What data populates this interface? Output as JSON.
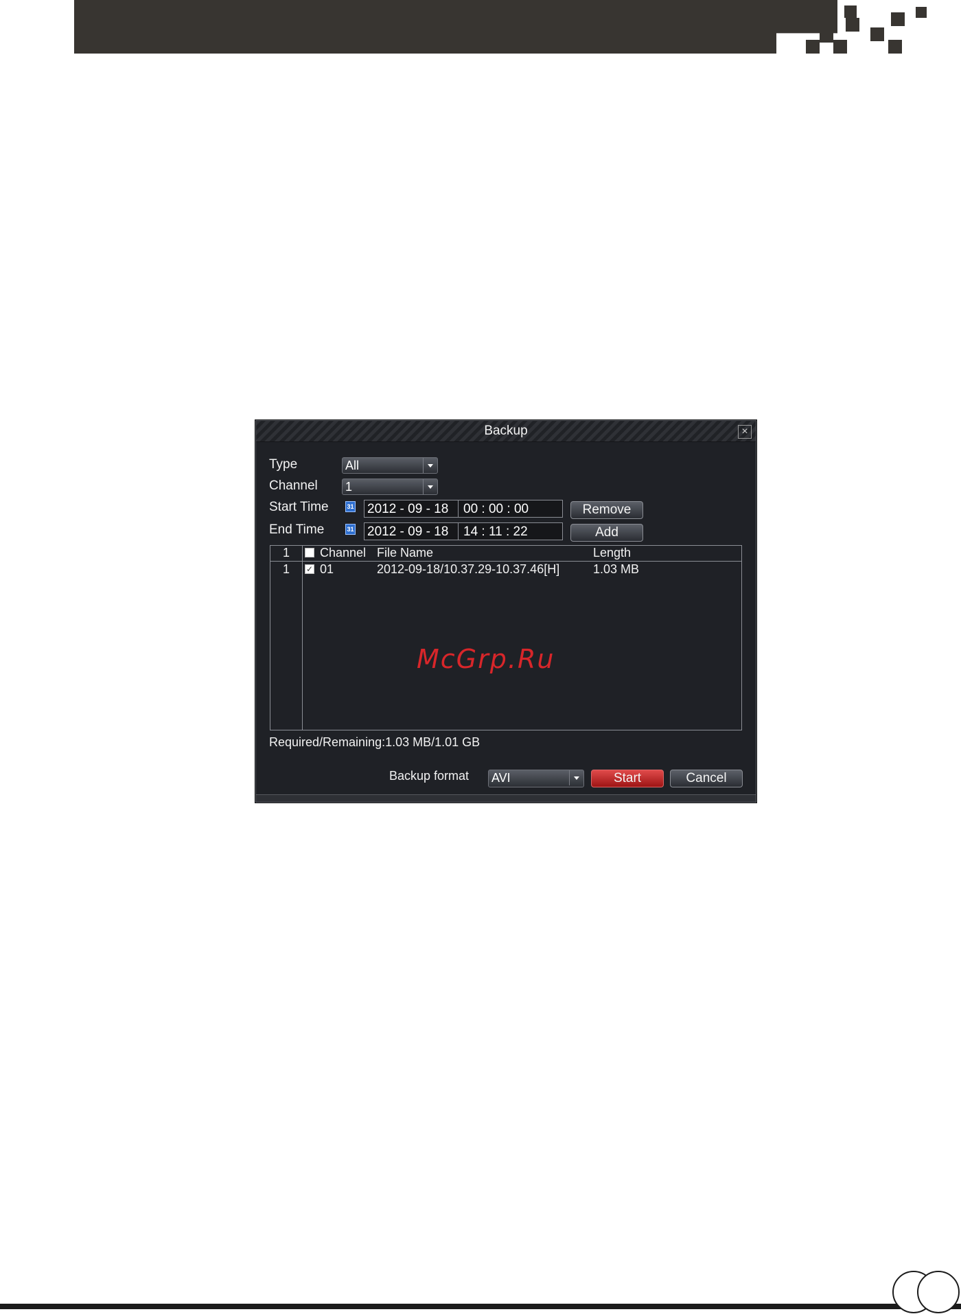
{
  "dialog": {
    "title": "Backup",
    "close_label": "×",
    "type": {
      "label": "Type",
      "value": "All"
    },
    "channel": {
      "label": "Channel",
      "value": "1"
    },
    "start_time": {
      "label": "Start Time",
      "date": "2012 - 09 - 18",
      "time": "00 : 00 : 00"
    },
    "end_time": {
      "label": "End Time",
      "date": "2012 - 09 - 18",
      "time": "14 : 11 : 22"
    },
    "calendar_icon_text": "31",
    "remove_label": "Remove",
    "add_label": "Add",
    "table": {
      "header_index": "1",
      "header_channel": "Channel",
      "header_filename": "File Name",
      "header_length": "Length",
      "rows": [
        {
          "index": "1",
          "checked": true,
          "channel": "01",
          "filename": "2012-09-18/10.37.29-10.37.46[H]",
          "length": "1.03 MB"
        }
      ]
    },
    "required_remaining": "Required/Remaining:1.03 MB/1.01 GB",
    "backup_format_label": "Backup format",
    "backup_format_value": "AVI",
    "start_label": "Start",
    "cancel_label": "Cancel"
  },
  "watermark": "McGrp.Ru",
  "colors": {
    "dialog_bg": "#1f2126",
    "header_bar": "#383531",
    "start_button": "#c82020",
    "watermark": "#d8262a"
  }
}
